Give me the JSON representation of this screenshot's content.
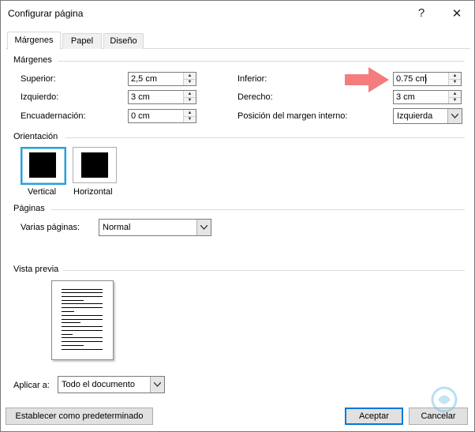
{
  "window": {
    "title": "Configurar página",
    "help_glyph": "?",
    "close_glyph": "✕"
  },
  "tabs": [
    {
      "label": "Márgenes",
      "active": true
    },
    {
      "label": "Papel",
      "active": false
    },
    {
      "label": "Diseño",
      "active": false
    }
  ],
  "margins": {
    "section_label": "Márgenes",
    "superior": {
      "label": "Superior:",
      "value": "2,5 cm"
    },
    "izquierdo": {
      "label": "Izquierdo:",
      "value": "3 cm"
    },
    "encuadernacion": {
      "label": "Encuadernación:",
      "value": "0 cm"
    },
    "inferior": {
      "label": "Inferior:",
      "value": "0.75 cm"
    },
    "derecho": {
      "label": "Derecho:",
      "value": "3 cm"
    },
    "posicion": {
      "label": "Posición del margen interno:",
      "value": "Izquierda"
    }
  },
  "orientation": {
    "section_label": "Orientación",
    "vertical": "Vertical",
    "horizontal": "Horizontal",
    "selected": "Vertical"
  },
  "pages": {
    "section_label": "Páginas",
    "multiple_label": "Varias páginas:",
    "multiple_value": "Normal"
  },
  "preview": {
    "section_label": "Vista previa"
  },
  "apply": {
    "label": "Aplicar a:",
    "value": "Todo el documento"
  },
  "footer": {
    "set_default": "Establecer como predeterminado",
    "ok": "Aceptar",
    "cancel": "Cancelar"
  },
  "annotation": {
    "arrow_color": "#f47c7c"
  },
  "colors": {
    "selection_border": "#26a0da",
    "default_button_border": "#0078d7"
  }
}
